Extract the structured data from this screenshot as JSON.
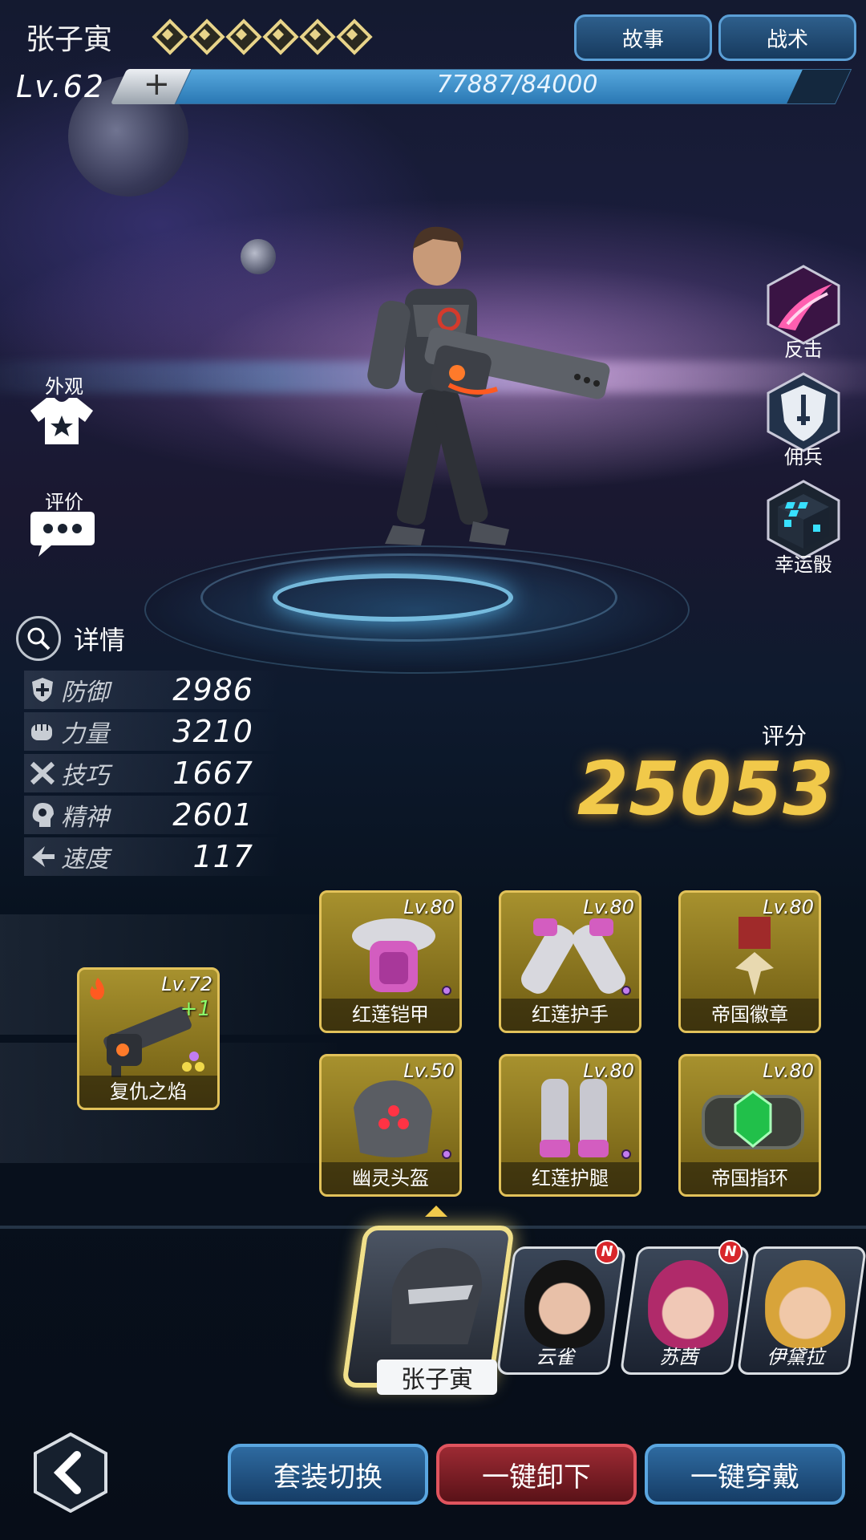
{
  "header": {
    "hero_name": "张子寅",
    "star_count": 6,
    "buttons": {
      "story": "故事",
      "tactics": "战术"
    }
  },
  "level": {
    "label": "Lv.62",
    "plus": "+",
    "exp_text": "77887/84000",
    "exp_current": 77887,
    "exp_max": 84000
  },
  "left_menu": {
    "appearance": "外观",
    "review": "评价"
  },
  "skills": {
    "counter": "反击",
    "mercenary": "佣兵",
    "lucky_dice": "幸运骰"
  },
  "details": {
    "label": "详情",
    "stats": [
      {
        "name": "防御",
        "value": "2986",
        "icon": "shield-plus-icon"
      },
      {
        "name": "力量",
        "value": "3210",
        "icon": "fist-icon"
      },
      {
        "name": "技巧",
        "value": "1667",
        "icon": "crossed-tools-icon"
      },
      {
        "name": "精神",
        "value": "2601",
        "icon": "head-brain-icon"
      },
      {
        "name": "速度",
        "value": "117",
        "icon": "speed-boot-icon"
      }
    ]
  },
  "score": {
    "label": "评分",
    "value": "25053"
  },
  "weapon": {
    "level": "Lv.72",
    "bonus": "+1",
    "name": "复仇之焰"
  },
  "equipment": [
    {
      "level": "Lv.80",
      "name": "红莲铠甲"
    },
    {
      "level": "Lv.80",
      "name": "红莲护手"
    },
    {
      "level": "Lv.80",
      "name": "帝国徽章"
    },
    {
      "level": "Lv.50",
      "name": "幽灵头盔"
    },
    {
      "level": "Lv.80",
      "name": "红莲护腿"
    },
    {
      "level": "Lv.80",
      "name": "帝国指环"
    }
  ],
  "roster": {
    "selected": "张子寅",
    "heroes": [
      {
        "name": "云雀",
        "badge": "N"
      },
      {
        "name": "苏茜",
        "badge": "N"
      },
      {
        "name": "伊黛拉",
        "badge": ""
      }
    ]
  },
  "bottom": {
    "switch_set": "套装切换",
    "unequip_all": "一键卸下",
    "equip_all": "一键穿戴"
  },
  "colors": {
    "score": "#f1c94a",
    "equip_frame": "#e2c25a",
    "button_blue": "#2e6aa0",
    "button_red": "#9c2a33"
  }
}
